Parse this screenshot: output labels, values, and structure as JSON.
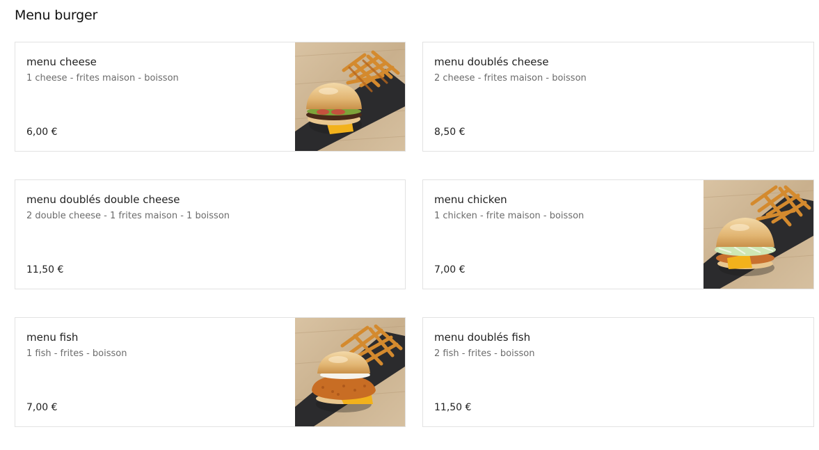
{
  "section": {
    "title": "Menu burger"
  },
  "items": [
    {
      "name": "menu cheese",
      "description": "1 cheese - frites maison - boisson",
      "price": "6,00 €",
      "image": "burger-fries-photo"
    },
    {
      "name": "menu doublés cheese",
      "description": "2 cheese - frites maison - boisson",
      "price": "8,50 €",
      "image": ""
    },
    {
      "name": "menu doublés double cheese",
      "description": "2 double cheese - 1 frites maison - 1 boisson",
      "price": "11,50 €",
      "image": ""
    },
    {
      "name": "menu chicken",
      "description": "1 chicken - frite maison - boisson",
      "price": "7,00 €",
      "image": "chicken-burger-fries-photo"
    },
    {
      "name": "menu fish",
      "description": "1 fish - frites - boisson",
      "price": "7,00 €",
      "image": "fish-burger-fries-photo"
    },
    {
      "name": "menu doublés fish",
      "description": "2 fish - frites - boisson",
      "price": "11,50 €",
      "image": ""
    }
  ]
}
